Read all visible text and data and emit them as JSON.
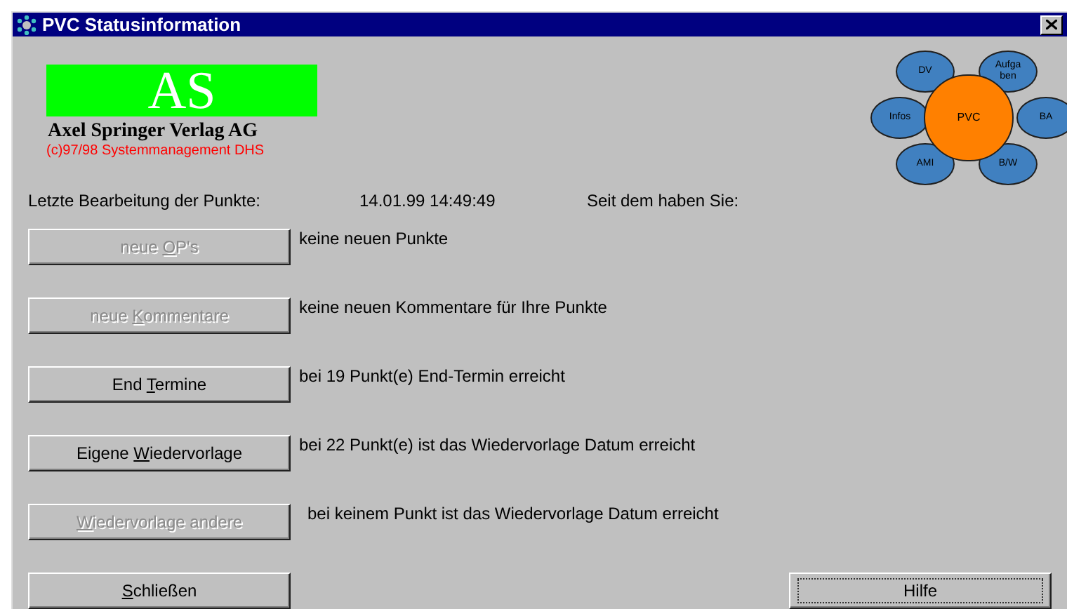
{
  "window": {
    "title": "PVC Statusinformation"
  },
  "logo": {
    "mark": "AS",
    "company": "Axel Springer Verlag AG",
    "copyright": "(c)97/98 Systemmanagement DHS"
  },
  "diagram": {
    "center": "PVC",
    "nodes": [
      {
        "label": "DV"
      },
      {
        "label": "Aufga ben"
      },
      {
        "label": "Infos"
      },
      {
        "label": "BA"
      },
      {
        "label": "AMI"
      },
      {
        "label": "B/W"
      }
    ]
  },
  "status": {
    "label": "Letzte Bearbeitung der Punkte:",
    "timestamp": "14.01.99 14:49:49",
    "since": "Seit dem haben Sie:"
  },
  "actions": [
    {
      "before": "neue ",
      "key": "O",
      "after": "P's",
      "disabled": true,
      "message": "keine neuen Punkte"
    },
    {
      "before": "neue ",
      "key": "K",
      "after": "ommentare",
      "disabled": true,
      "message": "keine neuen Kommentare für Ihre Punkte"
    },
    {
      "before": "End ",
      "key": "T",
      "after": "ermine",
      "disabled": false,
      "message": "bei 19 Punkt(e) End-Termin erreicht"
    },
    {
      "before": "Eigene ",
      "key": "W",
      "after": "iedervorlage",
      "disabled": false,
      "message": "bei 22 Punkt(e) ist das Wiedervorlage Datum erreicht"
    },
    {
      "key": "W",
      "after": "iedervorlage andere",
      "disabled": true,
      "message": "bei keinem Punkt ist das Wiedervorlage Datum erreicht"
    }
  ],
  "footer": {
    "close": {
      "key": "S",
      "after": "chließen",
      "focused": false
    },
    "help": {
      "after": "Hilfe",
      "focused": true
    }
  }
}
